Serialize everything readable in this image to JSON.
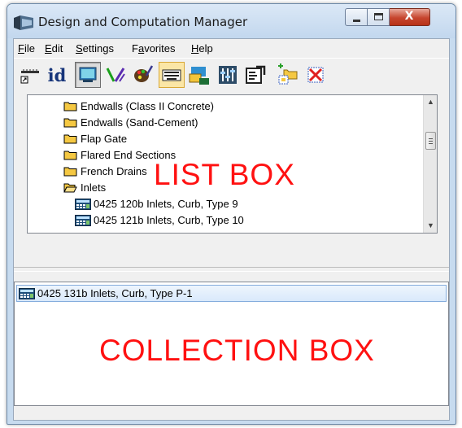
{
  "window": {
    "title": "Design and Computation Manager",
    "close_glyph": "X"
  },
  "menu": {
    "items": [
      {
        "label": "File",
        "underline": "F",
        "rest": "ile"
      },
      {
        "label": "Edit",
        "underline": "E",
        "rest": "dit"
      },
      {
        "label": "Settings",
        "underline": "S",
        "rest": "ettings"
      },
      {
        "label": "Favorites",
        "underline": "a",
        "prefix": "F",
        "rest": "vorites"
      },
      {
        "label": "Help",
        "underline": "H",
        "rest": "elp"
      }
    ]
  },
  "toolbar": {
    "id_label": "id",
    "tools": [
      "ruler-icon",
      "id-icon",
      "monitor-icon",
      "pencil-icon",
      "palette-icon",
      "keyboard-icon",
      "cursor-icon",
      "sliders-icon",
      "properties-icon",
      "add-folder-icon",
      "delete-icon"
    ]
  },
  "list_box": {
    "items": [
      {
        "type": "folder",
        "label": "Endwalls (Class II Concrete)"
      },
      {
        "type": "folder",
        "label": "Endwalls (Sand-Cement)"
      },
      {
        "type": "folder",
        "label": "Flap Gate"
      },
      {
        "type": "folder",
        "label": "Flared End Sections"
      },
      {
        "type": "folder",
        "label": "French Drains"
      },
      {
        "type": "folder-open",
        "label": "Inlets"
      },
      {
        "type": "item",
        "label": "0425  120b Inlets, Curb, Type 9"
      },
      {
        "type": "item",
        "label": "0425  121b Inlets, Curb, Type 10"
      }
    ],
    "annotation": "LIST BOX"
  },
  "collection_box": {
    "items": [
      {
        "label": "0425  131b Inlets, Curb, Type P-1"
      }
    ],
    "annotation": "COLLECTION BOX"
  },
  "colors": {
    "annotation": "#ff1111",
    "folder": "#f5c842",
    "selection": "#d9e9fb"
  }
}
